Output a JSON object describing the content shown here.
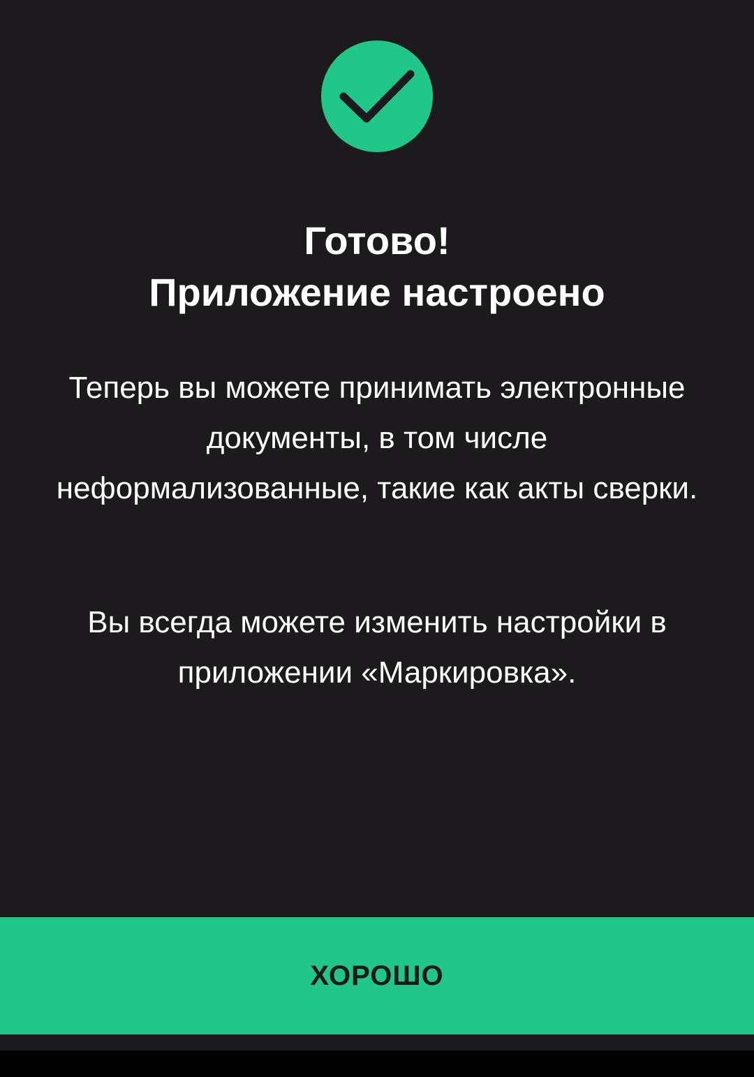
{
  "dialog": {
    "icon": "checkmark-circle-icon",
    "accent_color": "#20c68a",
    "background_color": "#1c1a1c",
    "title_line1": "Готово!",
    "title_line2": "Приложение настроено",
    "paragraph1": "Теперь вы можете принимать электронные документы, в том числе неформализованные, такие как акты сверки.",
    "paragraph2": "Вы всегда можете изменить настройки в приложении «Маркировка».",
    "ok_button_label": "ХОРОШО"
  }
}
